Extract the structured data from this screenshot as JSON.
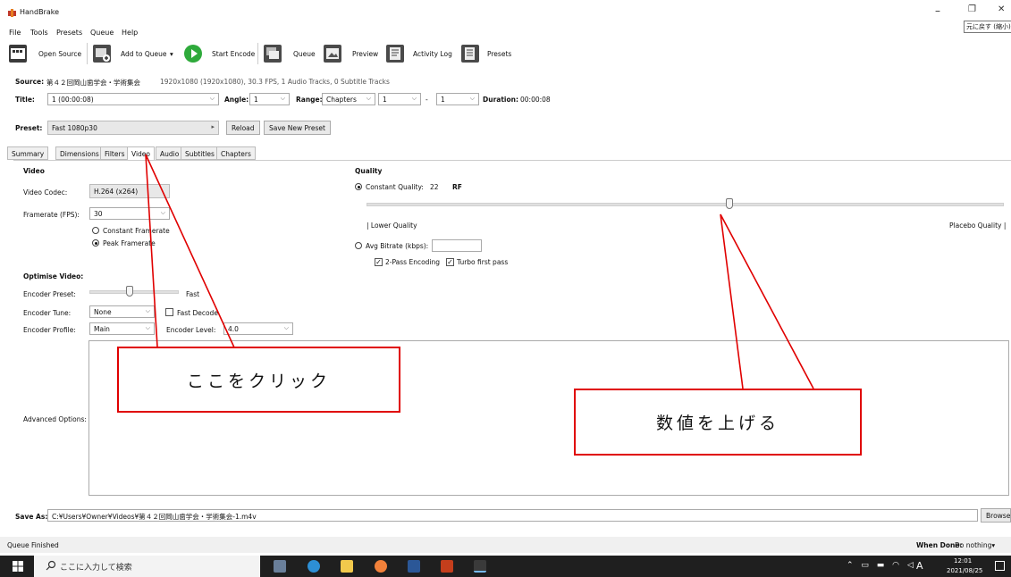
{
  "window": {
    "title": "HandBrake",
    "tooltip": "元に戻す (縮小)",
    "minimize_glyph": "–",
    "restore_glyph": "❐",
    "close_glyph": "✕"
  },
  "menu": [
    "File",
    "Tools",
    "Presets",
    "Queue",
    "Help"
  ],
  "toolbar": {
    "open_source": "Open Source",
    "add_to_queue": "Add to Queue",
    "start_encode": "Start Encode",
    "queue": "Queue",
    "preview": "Preview",
    "activity_log": "Activity Log",
    "presets": "Presets"
  },
  "source": {
    "label": "Source:",
    "name": "第４２回岡山歯学会・学術集会",
    "info": "1920x1080 (1920x1080), 30.3 FPS, 1 Audio Tracks, 0 Subtitle Tracks"
  },
  "title_row": {
    "title_label": "Title:",
    "title_value": "1 (00:00:08)",
    "angle_label": "Angle:",
    "angle_value": "1",
    "range_label": "Range:",
    "range_value": "Chapters",
    "range_start": "1",
    "range_dash": "-",
    "range_end": "1",
    "duration_label": "Duration:",
    "duration_value": "00:00:08"
  },
  "preset": {
    "label": "Preset:",
    "value": "Fast 1080p30",
    "reload": "Reload",
    "save_new": "Save New Preset"
  },
  "tabs": [
    "Summary",
    "Dimensions",
    "Filters",
    "Video",
    "Audio",
    "Subtitles",
    "Chapters"
  ],
  "active_tab": "Video",
  "video": {
    "section": "Video",
    "codec_label": "Video Codec:",
    "codec_value": "H.264 (x264)",
    "fps_label": "Framerate (FPS):",
    "fps_value": "30",
    "constant_framerate": "Constant Framerate",
    "peak_framerate": "Peak Framerate"
  },
  "quality": {
    "section": "Quality",
    "constant_quality_label": "Constant Quality:",
    "rf_value": "22",
    "rf_unit": "RF",
    "rf_slider_fraction": 0.57,
    "lower": "| Lower Quality",
    "placebo": "Placebo Quality |",
    "avg_bitrate_label": "Avg Bitrate (kbps):",
    "avg_bitrate_value": "",
    "two_pass": "2-Pass Encoding",
    "turbo": "Turbo first pass"
  },
  "optimise": {
    "section": "Optimise Video:",
    "preset_label": "Encoder Preset:",
    "preset_value": "Fast",
    "tune_label": "Encoder Tune:",
    "tune_value": "None",
    "fast_decode": "Fast Decode",
    "profile_label": "Encoder Profile:",
    "profile_value": "Main",
    "level_label": "Encoder Level:",
    "level_value": "4.0",
    "advanced_label": "Advanced Options:"
  },
  "annotations": {
    "click_here": "ここをクリック",
    "raise_value": "数値を上げる",
    "color": "#e00000"
  },
  "save_as": {
    "label": "Save As:",
    "path": "C:¥Users¥Owner¥Videos¥第４２回岡山歯学会・学術集会-1.m4v",
    "browse": "Browse"
  },
  "status": {
    "left": "Queue Finished",
    "when_done_label": "When Done:",
    "when_done_value": "Do nothing"
  },
  "taskbar": {
    "search_placeholder": "ここに入力して検索",
    "time": "12:01",
    "date": "2021/08/25",
    "ime": "A"
  }
}
